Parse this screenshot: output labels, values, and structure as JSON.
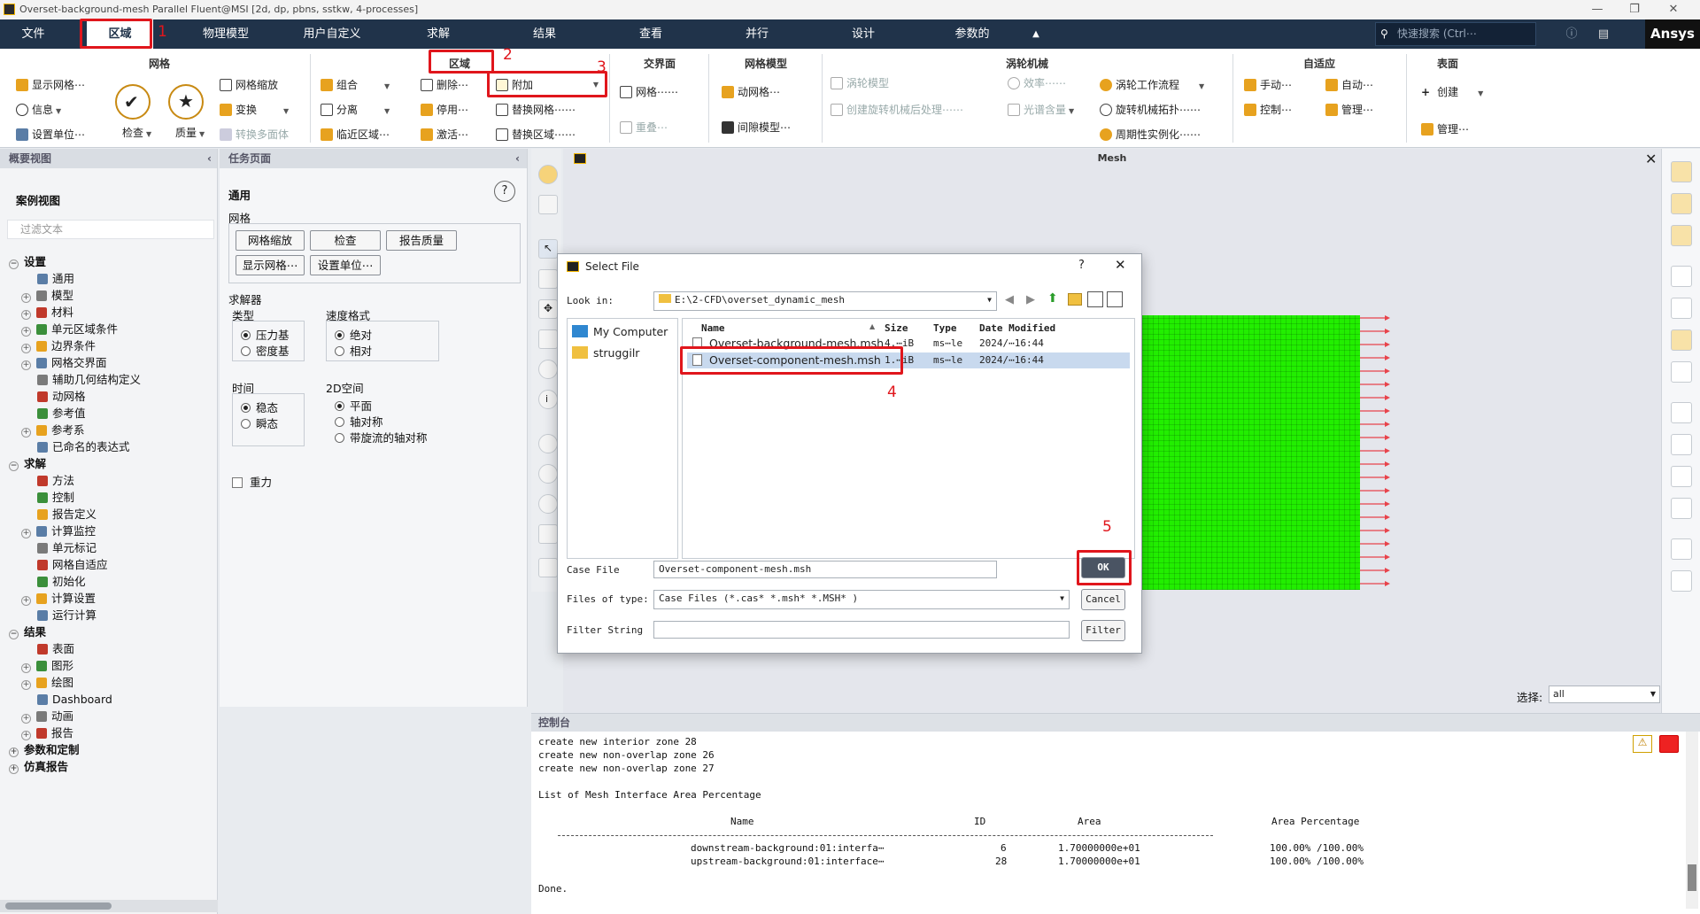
{
  "window": {
    "title": "Overset-background-mesh Parallel Fluent@MSI  [2d, dp, pbns, sstkw, 4-processes]"
  },
  "menu": {
    "items": [
      "文件",
      "区域",
      "物理模型",
      "用户自定义",
      "求解",
      "结果",
      "查看",
      "并行",
      "设计",
      "参数的"
    ],
    "search_placeholder": "快速搜索 (Ctrl⋯",
    "brand": "Ansys"
  },
  "ribbon": {
    "mesh": {
      "title": "网格",
      "show": "显示网格⋯",
      "info": "信息",
      "units": "设置单位⋯",
      "scale": "网格缩放",
      "transform": "变换",
      "to_poly": "转换多面体",
      "check": "检查",
      "quality": "质量"
    },
    "zone": {
      "title": "区域",
      "combine": "组合",
      "separate": "分离",
      "adjacency": "临近区域⋯",
      "delete": "删除⋯",
      "deactivate": "停用⋯",
      "activate": "激活⋯",
      "append": "附加",
      "replace_mesh": "替换网格⋯⋯",
      "replace_zone": "替换区域⋯⋯"
    },
    "interface": {
      "title": "交界面",
      "mesh": "网格⋯⋯",
      "overset": "重叠⋯"
    },
    "mesh_models": {
      "title": "网格模型",
      "dynamic": "动网格⋯",
      "gap": "间隙模型⋯"
    },
    "turbo": {
      "title": "涡轮机械",
      "turbo_model": "涡轮模型",
      "efficiency": "效率⋯⋯",
      "postproc": "创建旋转机械后处理⋯⋯",
      "spectral": "光谱含量",
      "workflow": "涡轮工作流程",
      "topology": "旋转机械拓扑⋯⋯",
      "periodic": "周期性实例化⋯⋯"
    },
    "adapt": {
      "title": "自适应",
      "manual": "手动⋯",
      "auto": "自动⋯",
      "control": "控制⋯",
      "manage": "管理⋯"
    },
    "surface": {
      "title": "表面",
      "create": "创建",
      "manage": "管理⋯"
    }
  },
  "annotations": [
    "1",
    "2",
    "3",
    "4",
    "5"
  ],
  "outline": {
    "header": "概要视图",
    "case_view": "案例视图",
    "filter_placeholder": "过滤文本",
    "items": [
      {
        "t": "设置",
        "lvl": 0,
        "exp": "−",
        "bold": true
      },
      {
        "t": "通用",
        "lvl": 2,
        "exp": ""
      },
      {
        "t": "模型",
        "lvl": 1,
        "exp": "+"
      },
      {
        "t": "材料",
        "lvl": 1,
        "exp": "+"
      },
      {
        "t": "单元区域条件",
        "lvl": 1,
        "exp": "+"
      },
      {
        "t": "边界条件",
        "lvl": 1,
        "exp": "+"
      },
      {
        "t": "网格交界面",
        "lvl": 1,
        "exp": "+"
      },
      {
        "t": "辅助几何结构定义",
        "lvl": 2,
        "exp": ""
      },
      {
        "t": "动网格",
        "lvl": 2,
        "exp": ""
      },
      {
        "t": "参考值",
        "lvl": 2,
        "exp": ""
      },
      {
        "t": "参考系",
        "lvl": 1,
        "exp": "+"
      },
      {
        "t": "已命名的表达式",
        "lvl": 2,
        "exp": ""
      },
      {
        "t": "求解",
        "lvl": 0,
        "exp": "−",
        "bold": true
      },
      {
        "t": "方法",
        "lvl": 2,
        "exp": ""
      },
      {
        "t": "控制",
        "lvl": 2,
        "exp": ""
      },
      {
        "t": "报告定义",
        "lvl": 2,
        "exp": ""
      },
      {
        "t": "计算监控",
        "lvl": 1,
        "exp": "+"
      },
      {
        "t": "单元标记",
        "lvl": 2,
        "exp": ""
      },
      {
        "t": "网格自适应",
        "lvl": 2,
        "exp": ""
      },
      {
        "t": "初始化",
        "lvl": 2,
        "exp": ""
      },
      {
        "t": "计算设置",
        "lvl": 1,
        "exp": "+"
      },
      {
        "t": "运行计算",
        "lvl": 2,
        "exp": ""
      },
      {
        "t": "结果",
        "lvl": 0,
        "exp": "−",
        "bold": true
      },
      {
        "t": "表面",
        "lvl": 2,
        "exp": ""
      },
      {
        "t": "图形",
        "lvl": 1,
        "exp": "+"
      },
      {
        "t": "绘图",
        "lvl": 1,
        "exp": "+"
      },
      {
        "t": "Dashboard",
        "lvl": 2,
        "exp": ""
      },
      {
        "t": "动画",
        "lvl": 1,
        "exp": "+"
      },
      {
        "t": "报告",
        "lvl": 1,
        "exp": "+"
      },
      {
        "t": "参数和定制",
        "lvl": 0,
        "exp": "+",
        "bold": true
      },
      {
        "t": "仿真报告",
        "lvl": 0,
        "exp": "+",
        "bold": true
      }
    ]
  },
  "task": {
    "header": "任务页面",
    "section": "通用",
    "mesh_label": "网格",
    "btn_scale": "网格缩放",
    "btn_check": "检查",
    "btn_report": "报告质量",
    "btn_display": "显示网格⋯",
    "btn_units": "设置单位⋯",
    "solver_label": "求解器",
    "type_label": "类型",
    "type_pressure": "压力基",
    "type_density": "密度基",
    "vel_label": "速度格式",
    "vel_abs": "绝对",
    "vel_rel": "相对",
    "time_label": "时间",
    "time_steady": "稳态",
    "time_transient": "瞬态",
    "space_label": "2D空间",
    "space_planar": "平面",
    "space_axi": "轴对称",
    "space_swirl": "带旋流的轴对称",
    "gravity": "重力"
  },
  "graphics": {
    "title": "Mesh",
    "select_label": "选择:",
    "select_value": "all"
  },
  "console": {
    "header": "控制台",
    "lines": [
      "create new interior zone 28",
      "create new non-overlap zone 26",
      "create new non-overlap zone 27",
      "",
      "List of Mesh Interface Area Percentage"
    ],
    "table_headers": [
      "Name",
      "ID",
      "Area",
      "Area Percentage"
    ],
    "rows": [
      [
        "downstream-background:01:interfa⋯",
        "6",
        "1.70000000e+01",
        "100.00% /100.00%"
      ],
      [
        "upstream-background:01:interface⋯",
        "28",
        "1.70000000e+01",
        "100.00% /100.00%"
      ]
    ],
    "done": "Done."
  },
  "dialog": {
    "title": "Select File",
    "help": "?",
    "look_in_label": "Look in:",
    "look_in_value": "E:\\2-CFD\\overset_dynamic_mesh",
    "places": [
      "My Computer",
      "struggilr"
    ],
    "cols": [
      "Name",
      "Size",
      "Type",
      "Date Modified"
    ],
    "files": [
      {
        "name": "Overset-background-mesh.msh",
        "size": "4.⋯iB",
        "type": "ms⋯le",
        "date": "2024/⋯16:44"
      },
      {
        "name": "Overset-component-mesh.msh",
        "size": "1.⋯iB",
        "type": "ms⋯le",
        "date": "2024/⋯16:44"
      }
    ],
    "case_file_label": "Case File",
    "case_file_value": "Overset-component-mesh.msh",
    "files_type_label": "Files of type:",
    "files_type_value": "Case Files (*.cas* *.msh* *.MSH* )",
    "filter_label": "Filter String",
    "filter_value": "",
    "ok": "OK",
    "cancel": "Cancel",
    "filter_btn": "Filter"
  },
  "colors": {
    "menubar": "#20334a",
    "accent_red": "#e0161c",
    "mesh_green": "#22ee00",
    "arrow": "#e8434b"
  }
}
